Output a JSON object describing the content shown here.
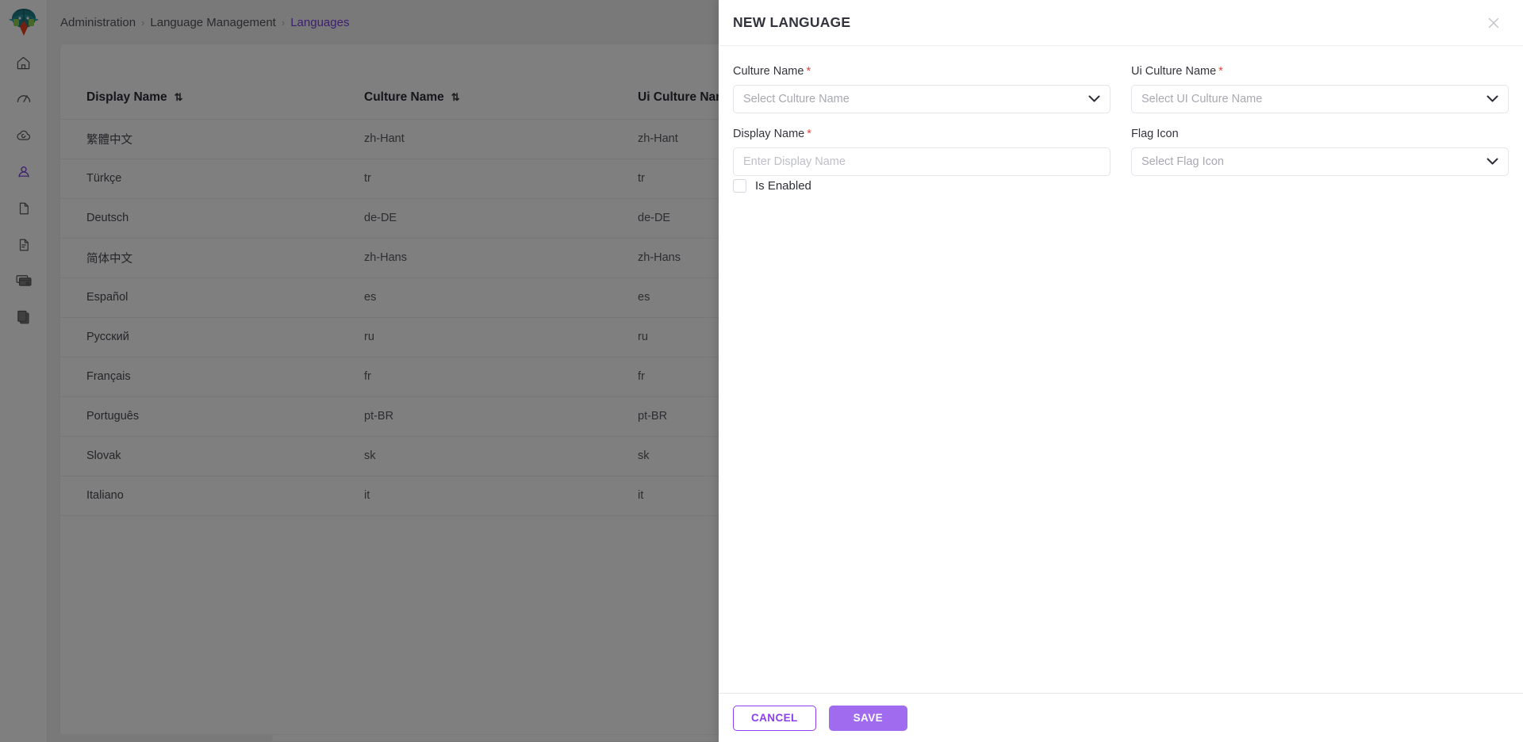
{
  "sidebar": {
    "logo_name": "app-logo",
    "items": [
      {
        "name": "home",
        "icon": "home-icon",
        "active": false
      },
      {
        "name": "dashboard",
        "icon": "speedometer-icon",
        "active": false
      },
      {
        "name": "saas",
        "icon": "cloud-icon",
        "active": false
      },
      {
        "name": "administration",
        "icon": "user-icon",
        "active": true
      },
      {
        "name": "forms",
        "icon": "file-icon",
        "active": false
      },
      {
        "name": "reports",
        "icon": "document-icon",
        "active": false
      },
      {
        "name": "payments",
        "icon": "credit-card-icon",
        "active": false
      },
      {
        "name": "devices",
        "icon": "tablet-icon",
        "active": false
      }
    ]
  },
  "breadcrumb": {
    "separator": "›",
    "items": [
      {
        "label": "Administration",
        "current": false
      },
      {
        "label": "Language Management",
        "current": false
      },
      {
        "label": "Languages",
        "current": true
      }
    ]
  },
  "table": {
    "sort_icon": "⇅",
    "columns": [
      {
        "key": "display_name",
        "label": "Display Name",
        "sortable": true
      },
      {
        "key": "culture_name",
        "label": "Culture Name",
        "sortable": true
      },
      {
        "key": "ui_culture_name",
        "label": "Ui Culture Name",
        "sortable": false
      },
      {
        "key": "spacer",
        "label": "",
        "sortable": false
      }
    ],
    "rows": [
      {
        "display_name": "繁體中文",
        "culture_name": "zh-Hant",
        "ui_culture_name": "zh-Hant"
      },
      {
        "display_name": "Türkçe",
        "culture_name": "tr",
        "ui_culture_name": "tr"
      },
      {
        "display_name": "Deutsch",
        "culture_name": "de-DE",
        "ui_culture_name": "de-DE"
      },
      {
        "display_name": "简体中文",
        "culture_name": "zh-Hans",
        "ui_culture_name": "zh-Hans"
      },
      {
        "display_name": "Español",
        "culture_name": "es",
        "ui_culture_name": "es"
      },
      {
        "display_name": "Русский",
        "culture_name": "ru",
        "ui_culture_name": "ru"
      },
      {
        "display_name": "Français",
        "culture_name": "fr",
        "ui_culture_name": "fr"
      },
      {
        "display_name": "Português",
        "culture_name": "pt-BR",
        "ui_culture_name": "pt-BR"
      },
      {
        "display_name": "Slovak",
        "culture_name": "sk",
        "ui_culture_name": "sk"
      },
      {
        "display_name": "Italiano",
        "culture_name": "it",
        "ui_culture_name": "it"
      }
    ]
  },
  "drawer": {
    "title": "NEW LANGUAGE",
    "close_icon": "close-icon",
    "required_marker": "*",
    "fields": {
      "culture_name": {
        "label": "Culture Name",
        "placeholder": "Select Culture Name",
        "required": true,
        "type": "select"
      },
      "ui_culture_name": {
        "label": "Ui Culture Name",
        "placeholder": "Select UI Culture Name",
        "required": true,
        "type": "select"
      },
      "display_name": {
        "label": "Display Name",
        "placeholder": "Enter Display Name",
        "required": true,
        "type": "text",
        "value": ""
      },
      "flag_icon": {
        "label": "Flag Icon",
        "placeholder": "Select Flag Icon",
        "required": false,
        "type": "select"
      }
    },
    "is_enabled": {
      "label": "Is Enabled",
      "checked": false
    },
    "buttons": {
      "cancel": "CANCEL",
      "save": "SAVE"
    }
  },
  "colors": {
    "accent": "#7a3fe0",
    "save_button": "#a06bef",
    "cancel_border": "#8b3ff0",
    "required": "#e8443a",
    "page_bg": "#f2f2f2",
    "overlay": "rgba(0,0,0,0.50)"
  }
}
